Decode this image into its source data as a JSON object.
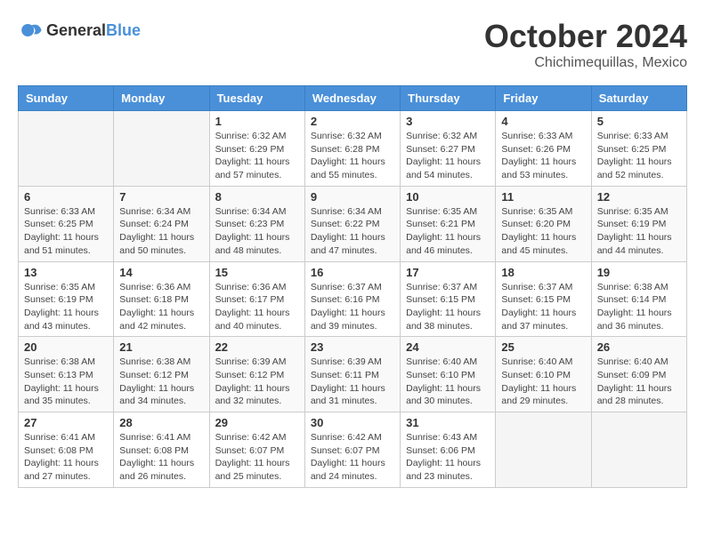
{
  "header": {
    "logo": {
      "general": "General",
      "blue": "Blue"
    },
    "title": "October 2024",
    "subtitle": "Chichimequillas, Mexico"
  },
  "weekdays": [
    "Sunday",
    "Monday",
    "Tuesday",
    "Wednesday",
    "Thursday",
    "Friday",
    "Saturday"
  ],
  "weeks": [
    [
      {
        "day": "",
        "info": ""
      },
      {
        "day": "",
        "info": ""
      },
      {
        "day": "1",
        "info": "Sunrise: 6:32 AM\nSunset: 6:29 PM\nDaylight: 11 hours and 57 minutes."
      },
      {
        "day": "2",
        "info": "Sunrise: 6:32 AM\nSunset: 6:28 PM\nDaylight: 11 hours and 55 minutes."
      },
      {
        "day": "3",
        "info": "Sunrise: 6:32 AM\nSunset: 6:27 PM\nDaylight: 11 hours and 54 minutes."
      },
      {
        "day": "4",
        "info": "Sunrise: 6:33 AM\nSunset: 6:26 PM\nDaylight: 11 hours and 53 minutes."
      },
      {
        "day": "5",
        "info": "Sunrise: 6:33 AM\nSunset: 6:25 PM\nDaylight: 11 hours and 52 minutes."
      }
    ],
    [
      {
        "day": "6",
        "info": "Sunrise: 6:33 AM\nSunset: 6:25 PM\nDaylight: 11 hours and 51 minutes."
      },
      {
        "day": "7",
        "info": "Sunrise: 6:34 AM\nSunset: 6:24 PM\nDaylight: 11 hours and 50 minutes."
      },
      {
        "day": "8",
        "info": "Sunrise: 6:34 AM\nSunset: 6:23 PM\nDaylight: 11 hours and 48 minutes."
      },
      {
        "day": "9",
        "info": "Sunrise: 6:34 AM\nSunset: 6:22 PM\nDaylight: 11 hours and 47 minutes."
      },
      {
        "day": "10",
        "info": "Sunrise: 6:35 AM\nSunset: 6:21 PM\nDaylight: 11 hours and 46 minutes."
      },
      {
        "day": "11",
        "info": "Sunrise: 6:35 AM\nSunset: 6:20 PM\nDaylight: 11 hours and 45 minutes."
      },
      {
        "day": "12",
        "info": "Sunrise: 6:35 AM\nSunset: 6:19 PM\nDaylight: 11 hours and 44 minutes."
      }
    ],
    [
      {
        "day": "13",
        "info": "Sunrise: 6:35 AM\nSunset: 6:19 PM\nDaylight: 11 hours and 43 minutes."
      },
      {
        "day": "14",
        "info": "Sunrise: 6:36 AM\nSunset: 6:18 PM\nDaylight: 11 hours and 42 minutes."
      },
      {
        "day": "15",
        "info": "Sunrise: 6:36 AM\nSunset: 6:17 PM\nDaylight: 11 hours and 40 minutes."
      },
      {
        "day": "16",
        "info": "Sunrise: 6:37 AM\nSunset: 6:16 PM\nDaylight: 11 hours and 39 minutes."
      },
      {
        "day": "17",
        "info": "Sunrise: 6:37 AM\nSunset: 6:15 PM\nDaylight: 11 hours and 38 minutes."
      },
      {
        "day": "18",
        "info": "Sunrise: 6:37 AM\nSunset: 6:15 PM\nDaylight: 11 hours and 37 minutes."
      },
      {
        "day": "19",
        "info": "Sunrise: 6:38 AM\nSunset: 6:14 PM\nDaylight: 11 hours and 36 minutes."
      }
    ],
    [
      {
        "day": "20",
        "info": "Sunrise: 6:38 AM\nSunset: 6:13 PM\nDaylight: 11 hours and 35 minutes."
      },
      {
        "day": "21",
        "info": "Sunrise: 6:38 AM\nSunset: 6:12 PM\nDaylight: 11 hours and 34 minutes."
      },
      {
        "day": "22",
        "info": "Sunrise: 6:39 AM\nSunset: 6:12 PM\nDaylight: 11 hours and 32 minutes."
      },
      {
        "day": "23",
        "info": "Sunrise: 6:39 AM\nSunset: 6:11 PM\nDaylight: 11 hours and 31 minutes."
      },
      {
        "day": "24",
        "info": "Sunrise: 6:40 AM\nSunset: 6:10 PM\nDaylight: 11 hours and 30 minutes."
      },
      {
        "day": "25",
        "info": "Sunrise: 6:40 AM\nSunset: 6:10 PM\nDaylight: 11 hours and 29 minutes."
      },
      {
        "day": "26",
        "info": "Sunrise: 6:40 AM\nSunset: 6:09 PM\nDaylight: 11 hours and 28 minutes."
      }
    ],
    [
      {
        "day": "27",
        "info": "Sunrise: 6:41 AM\nSunset: 6:08 PM\nDaylight: 11 hours and 27 minutes."
      },
      {
        "day": "28",
        "info": "Sunrise: 6:41 AM\nSunset: 6:08 PM\nDaylight: 11 hours and 26 minutes."
      },
      {
        "day": "29",
        "info": "Sunrise: 6:42 AM\nSunset: 6:07 PM\nDaylight: 11 hours and 25 minutes."
      },
      {
        "day": "30",
        "info": "Sunrise: 6:42 AM\nSunset: 6:07 PM\nDaylight: 11 hours and 24 minutes."
      },
      {
        "day": "31",
        "info": "Sunrise: 6:43 AM\nSunset: 6:06 PM\nDaylight: 11 hours and 23 minutes."
      },
      {
        "day": "",
        "info": ""
      },
      {
        "day": "",
        "info": ""
      }
    ]
  ]
}
